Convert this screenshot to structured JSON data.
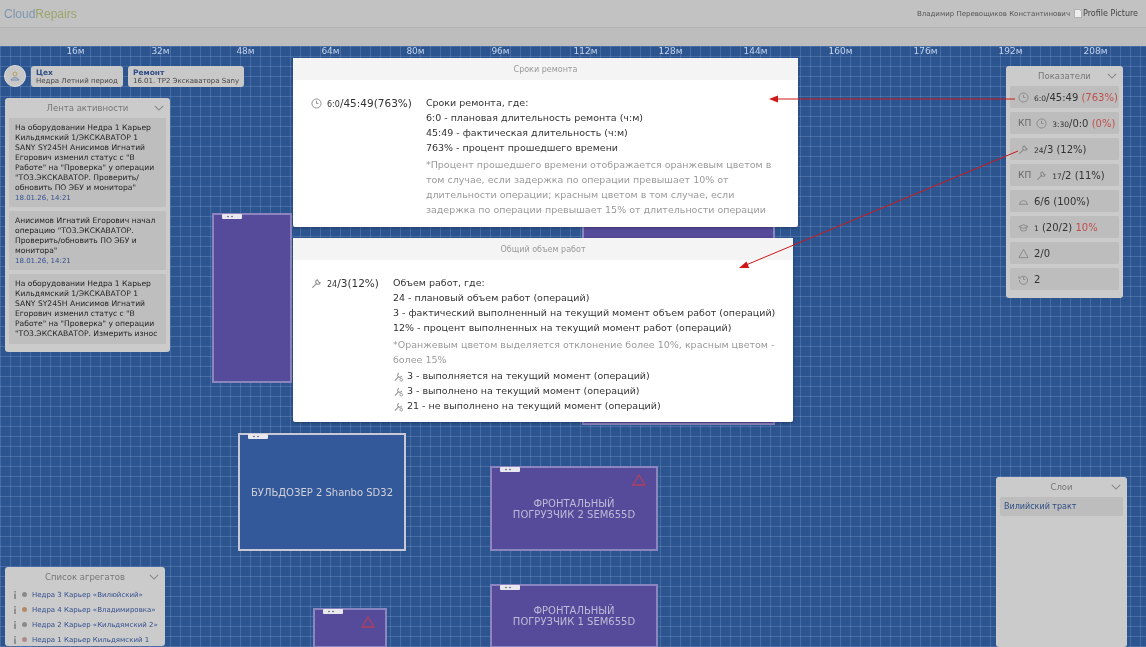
{
  "header": {
    "logo_first": "Cloud",
    "logo_second": "Repairs",
    "user_name": "Владимир Перевощиков Константинович",
    "profile_picture_alt": "Profile Picture"
  },
  "ruler": [
    "16м",
    "32м",
    "48м",
    "64м",
    "80м",
    "96м",
    "112м",
    "128м",
    "144м",
    "160м",
    "176м",
    "192м",
    "208м"
  ],
  "chips": [
    {
      "title": "Цех",
      "subtitle": "Недра Летний период"
    },
    {
      "title": "Ремонт",
      "subtitle": "16.01. ТР2 Экскаватора Sany"
    }
  ],
  "activity_feed": {
    "title": "Лента активности",
    "items": [
      {
        "text": "На оборудовании Недра 1 Карьер Кильдямский 1/ЭКСКАВАТОР 1 SANY SY245H Анисимов Игнатий Егорович изменил статус с \"В Работе\" на \"Проверка\" у операции \"ТО3.ЭКСКАВАТОР. Проверить/обновить ПО ЭБУ и монитора\"",
        "date": "18.01.26, 14:21"
      },
      {
        "text": "Анисимов Игнатий Егорович начал операцию \"ТО3.ЭКСКАВАТОР. Проверить/обновить ПО ЭБУ и монитора\"",
        "date": "18.01.26, 14:21"
      },
      {
        "text": "На оборудовании Недра 1 Карьер Кильдямский 1/ЭКСКАВАТОР 1 SANY SY245H Анисимов Игнатий Егорович изменил статус с \"В Работе\" на \"Проверка\" у операции \"ТО3.ЭКСКАВАТОР. Измерить износ"
      }
    ]
  },
  "aggregates": {
    "title": "Список агрегатов",
    "items": [
      {
        "name": "Недра 3 Карьер «Вилюйский»",
        "color": "#8a8a8a"
      },
      {
        "name": "Недра 4 Карьер «Владимировка»",
        "color": "#b08a6a"
      },
      {
        "name": "Недра 2 Карьер «Кильдямский 2»",
        "color": "#8a8a8a"
      },
      {
        "name": "Недра 1 Карьер Кильдямский 1",
        "color": "#b08a8a"
      }
    ]
  },
  "machines": [
    {
      "kind": "filled",
      "warning": false
    },
    {
      "kind": "filled",
      "warning": false
    },
    {
      "kind": "outline",
      "name": "БУЛЬДОЗЕР 2 Shanbo SD32",
      "warning": false
    },
    {
      "kind": "filled",
      "name": "ФРОНТАЛЬНЫЙ ПОГРУЗЧИК 2 SEM655D",
      "warning": true
    },
    {
      "kind": "filled",
      "name": "ФРОНТАЛЬНЫЙ ПОГРУЗЧИК 1 SEM655D",
      "warning": false
    },
    {
      "kind": "filled",
      "warning": true
    }
  ],
  "indicators": {
    "title": "Показатели",
    "items": [
      {
        "kind": "time",
        "small": "6:0",
        "main": "/45:49 ",
        "accent": "(763%)"
      },
      {
        "kind": "time",
        "prefix": "КП",
        "small": "3:30",
        "main": "/0:0 ",
        "accent": "(0%)"
      },
      {
        "kind": "volume",
        "small": "24",
        "main": "/3 (12%)"
      },
      {
        "kind": "volume",
        "prefix": "КП",
        "small": "17",
        "main": "/2 (11%)"
      },
      {
        "kind": "staff",
        "main": "6/6 (100%)"
      },
      {
        "kind": "training",
        "small": "1",
        "main": " (20/2) ",
        "accent": "10%"
      },
      {
        "kind": "alerts",
        "main": "2/0"
      },
      {
        "kind": "history",
        "main": "2"
      }
    ]
  },
  "layers": {
    "title": "Слои",
    "items": [
      {
        "label": "Вилийский тракт",
        "selected": true
      }
    ]
  },
  "popups": [
    {
      "title": "Сроки ремонта",
      "kind": "time",
      "value_small": "6:0",
      "value_main": "/45:49(763%)",
      "lines": [
        {
          "kind": "heading",
          "text": "Сроки ремонта, где:"
        },
        {
          "kind": "text",
          "text": "6:0 - плановая длительность ремонта (ч:м)"
        },
        {
          "kind": "text",
          "text": "45:49 - фактическая длительность (ч:м)"
        },
        {
          "kind": "text",
          "text": "763% - процент прошедшего времени"
        },
        {
          "kind": "note",
          "text": "*Процент прошедшего времени отображается оранжевым цветом в том случае, если задержка по операции превышает 10% от длительности операции; красным цветом в том случае, если задержка по операции превышает 15% от длительности операции"
        }
      ]
    },
    {
      "title": "Общий объем работ",
      "kind": "volume",
      "value_small": "24",
      "value_main": "/3(12%)",
      "lines": [
        {
          "kind": "heading",
          "text": "Объем работ, где:"
        },
        {
          "kind": "text",
          "text": "24 - плановый объем работ (операций)"
        },
        {
          "kind": "text",
          "text": "3 - фактический выполненный на текущий момент объем работ (операций)"
        },
        {
          "kind": "text",
          "text": "12% - процент выполненных на текущий момент работ (операций)"
        },
        {
          "kind": "note",
          "text": "*Оранжевым цветом выделяется отклонение более 10%, красным цветом - более 15%"
        },
        {
          "kind": "tool",
          "text": "3 - выполняется на текущий момент (операций)"
        },
        {
          "kind": "tool",
          "text": "3 - выполнено на текущий момент (операций)"
        },
        {
          "kind": "tool",
          "text": "21 - не выполнено на текущий момент (операций)"
        }
      ]
    }
  ]
}
